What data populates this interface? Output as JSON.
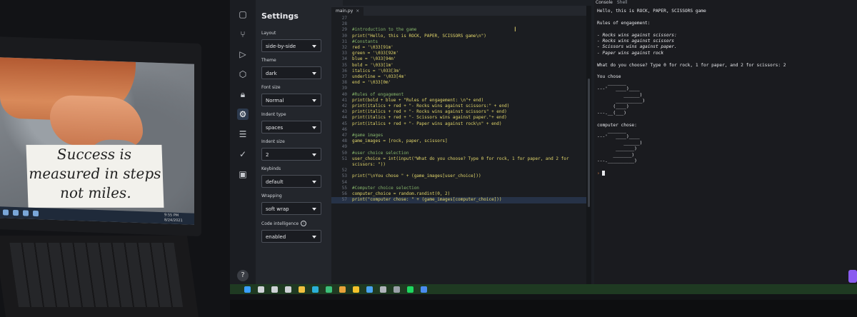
{
  "laptop": {
    "quote_lines": [
      "Success is",
      "measured in steps",
      "not miles."
    ],
    "clock": [
      "9:55 PM",
      "8/24/2021"
    ]
  },
  "settings": {
    "title": "Settings",
    "items": [
      {
        "label": "Layout",
        "value": "side-by-side"
      },
      {
        "label": "Theme",
        "value": "dark"
      },
      {
        "label": "Font size",
        "value": "Normal"
      },
      {
        "label": "Indent type",
        "value": "spaces"
      },
      {
        "label": "Indent size",
        "value": "2"
      },
      {
        "label": "Keybinds",
        "value": "default"
      },
      {
        "label": "Wrapping",
        "value": "soft wrap"
      },
      {
        "label": "Code intelligence",
        "value": "enabled"
      }
    ],
    "help": "?"
  },
  "rail": {
    "icons": [
      "files-icon",
      "git-branch-icon",
      "debugger-icon",
      "packages-icon",
      "lock-icon",
      "settings-icon",
      "database-icon",
      "check-icon",
      "unit-tests-icon"
    ]
  },
  "editor": {
    "tab_label": "main.py",
    "tab_close": "×",
    "lines": [
      {
        "n": "27",
        "t": "",
        "c": false
      },
      {
        "n": "28",
        "t": "",
        "c": false
      },
      {
        "n": "29",
        "t": "#introduction to the game",
        "c": true
      },
      {
        "n": "30",
        "t": "print(\"Hello, this is ROCK, PAPER, SCISSORS game\\n\")",
        "c": false
      },
      {
        "n": "31",
        "t": "#Constants",
        "c": true
      },
      {
        "n": "32",
        "t": "red = '\\033[91m'",
        "c": false
      },
      {
        "n": "33",
        "t": "green = '\\033[92m'",
        "c": false
      },
      {
        "n": "34",
        "t": "blue = '\\033[94m'",
        "c": false
      },
      {
        "n": "35",
        "t": "bold = '\\033[1m'",
        "c": false
      },
      {
        "n": "36",
        "t": "italics = '\\033[3m'",
        "c": false
      },
      {
        "n": "37",
        "t": "underline = '\\033[4m'",
        "c": false
      },
      {
        "n": "38",
        "t": "end = '\\033[0m'",
        "c": false
      },
      {
        "n": "39",
        "t": "",
        "c": false
      },
      {
        "n": "40",
        "t": "#Rules of engagement",
        "c": true
      },
      {
        "n": "41",
        "t": "print(bold + blue + \"Rules of engagement: \\n\"+ end)",
        "c": false
      },
      {
        "n": "42",
        "t": "print(italics + red + \"- Rocks wins against scissors:\" + end)",
        "c": false
      },
      {
        "n": "43",
        "t": "print(italics + red + \"- Rocks wins against scissors\" + end)",
        "c": false
      },
      {
        "n": "44",
        "t": "print(italics + red + \"- Scissors wins against paper.\"+ end)",
        "c": false
      },
      {
        "n": "45",
        "t": "print(italics + red + \"- Paper wins against rock\\n\" + end)",
        "c": false
      },
      {
        "n": "46",
        "t": "",
        "c": false
      },
      {
        "n": "47",
        "t": "#game images",
        "c": true
      },
      {
        "n": "48",
        "t": "game_images = [rock, paper, scissors]",
        "c": false
      },
      {
        "n": "49",
        "t": "",
        "c": false
      },
      {
        "n": "50",
        "t": "#user choice selection",
        "c": true
      },
      {
        "n": "51",
        "t": "user_choice = int(input(\"What do you choose? Type 0 for rock, 1 for paper, and 2 for",
        "c": false
      },
      {
        "n": "",
        "t": "scissors: \"))",
        "c": false
      },
      {
        "n": "52",
        "t": "",
        "c": false
      },
      {
        "n": "53",
        "t": "print(\"\\nYou chose \" + (game_images[user_choice]))",
        "c": false
      },
      {
        "n": "54",
        "t": "",
        "c": false
      },
      {
        "n": "55",
        "t": "#Computer choice selection",
        "c": true
      },
      {
        "n": "56",
        "t": "computer_choice = random.randint(0, 2)",
        "c": false
      },
      {
        "n": "57",
        "t": "print(\"computer chose: \" + (game_images[computer_choice]))",
        "c": false
      }
    ],
    "current_line_index": 31,
    "cursor_glyph": "I"
  },
  "console": {
    "tabs": [
      "Console",
      "Shell"
    ],
    "lines": [
      {
        "t": "Hello, this is ROCK, PAPER, SCISSORS game",
        "s": ""
      },
      {
        "t": "",
        "s": ""
      },
      {
        "t": "Rules of engagement:",
        "s": ""
      },
      {
        "t": "",
        "s": ""
      },
      {
        "t": "- Rocks wins against scissors:",
        "s": "it"
      },
      {
        "t": "- Rocks wins against scissors",
        "s": "it"
      },
      {
        "t": "- Scissors wins against paper.",
        "s": "it"
      },
      {
        "t": "- Paper wins against rock",
        "s": "it"
      },
      {
        "t": "",
        "s": ""
      },
      {
        "t": "What do you choose? Type 0 for rock, 1 for paper, and 2 for scissors: 2",
        "s": ""
      },
      {
        "t": "",
        "s": ""
      },
      {
        "t": "You chose",
        "s": ""
      },
      {
        "t": "    _______",
        "s": ""
      },
      {
        "t": "---'   ____)____",
        "s": ""
      },
      {
        "t": "          ______)",
        "s": ""
      },
      {
        "t": "       __________)",
        "s": ""
      },
      {
        "t": "      (____)",
        "s": ""
      },
      {
        "t": "---.__(___)",
        "s": ""
      },
      {
        "t": "",
        "s": ""
      },
      {
        "t": "computer chose:",
        "s": ""
      },
      {
        "t": "    _______",
        "s": ""
      },
      {
        "t": "---'   ____)____",
        "s": ""
      },
      {
        "t": "          ______)",
        "s": ""
      },
      {
        "t": "       _______)",
        "s": ""
      },
      {
        "t": "      _______)",
        "s": ""
      },
      {
        "t": "---.__________)",
        "s": ""
      },
      {
        "t": "",
        "s": ""
      }
    ],
    "prompt": "› "
  },
  "taskbar": {
    "icons": [
      {
        "name": "start-icon",
        "color": "#3aa0ff"
      },
      {
        "name": "search-icon",
        "color": "#cfd2d7"
      },
      {
        "name": "cortana-icon",
        "color": "#cfd2d7"
      },
      {
        "name": "task-view-icon",
        "color": "#cfd2d7"
      },
      {
        "name": "explorer-icon",
        "color": "#f0c040"
      },
      {
        "name": "edge-icon",
        "color": "#2bb0d8"
      },
      {
        "name": "edge-beta-icon",
        "color": "#3cc07a"
      },
      {
        "name": "app-icon",
        "color": "#e8a23a"
      },
      {
        "name": "chrome-icon",
        "color": "#f3c22b"
      },
      {
        "name": "phone-icon",
        "color": "#4aa3f0"
      },
      {
        "name": "photos-icon",
        "color": "#b0b4bb"
      },
      {
        "name": "settings-icon",
        "color": "#9aa0a8"
      },
      {
        "name": "spotify-icon",
        "color": "#1ed760"
      },
      {
        "name": "store-icon",
        "color": "#4a8cf0"
      }
    ]
  }
}
